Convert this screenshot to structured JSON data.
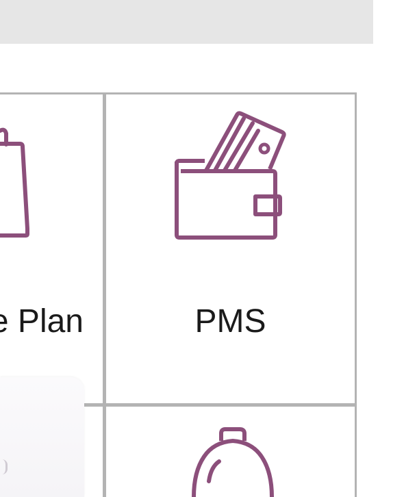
{
  "colors": {
    "icon": "#8c4f7b",
    "grid": "#b3b3b3",
    "topbar": "#e6e6e6",
    "text": "#1a1a1a"
  },
  "topbar": {
    "label": ""
  },
  "tiles": [
    {
      "label": "e Plan",
      "icon": "shopping-bag-icon"
    },
    {
      "label": "PMS",
      "icon": "wallet-card-icon"
    },
    {
      "label": "",
      "icon": "bell-icon"
    }
  ]
}
